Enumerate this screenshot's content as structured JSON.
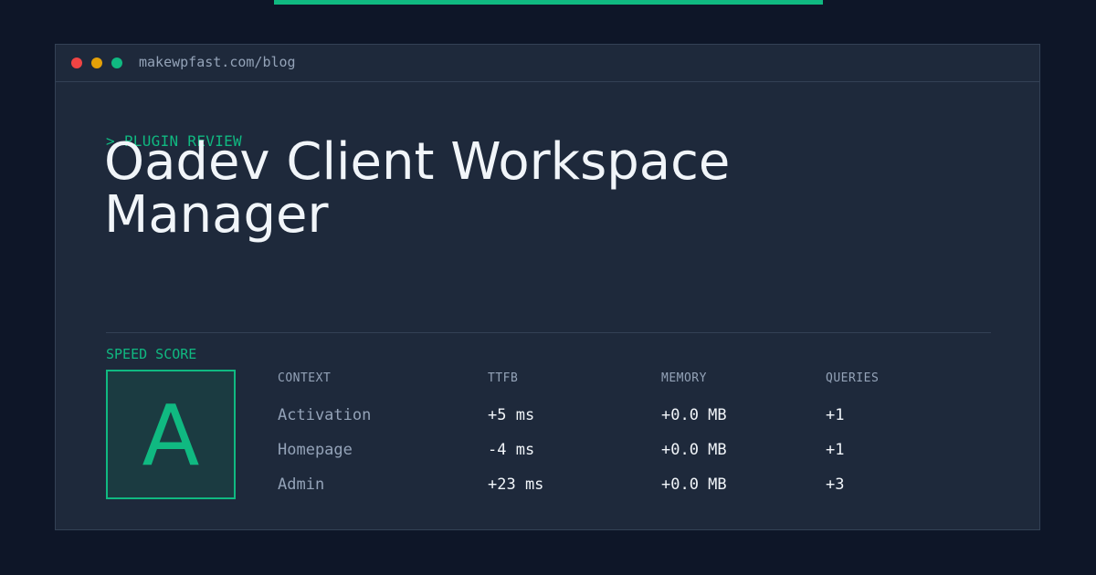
{
  "browser": {
    "url": "makewpfast.com/blog"
  },
  "post": {
    "kicker": "> PLUGIN REVIEW",
    "title": "Oadev Client Workspace Manager"
  },
  "speed": {
    "label": "SPEED SCORE",
    "grade": "A"
  },
  "table": {
    "headers": [
      "CONTEXT",
      "TTFB",
      "MEMORY",
      "QUERIES"
    ],
    "rows": [
      [
        "Activation",
        "+5 ms",
        "+0.0 MB",
        "+1"
      ],
      [
        "Homepage",
        "-4 ms",
        "+0.0 MB",
        "+1"
      ],
      [
        "Admin",
        "+23 ms",
        "+0.0 MB",
        "+3"
      ]
    ]
  },
  "colors": {
    "accent": "#10b981",
    "background": "#0e1628",
    "panel": "#1e293b"
  }
}
